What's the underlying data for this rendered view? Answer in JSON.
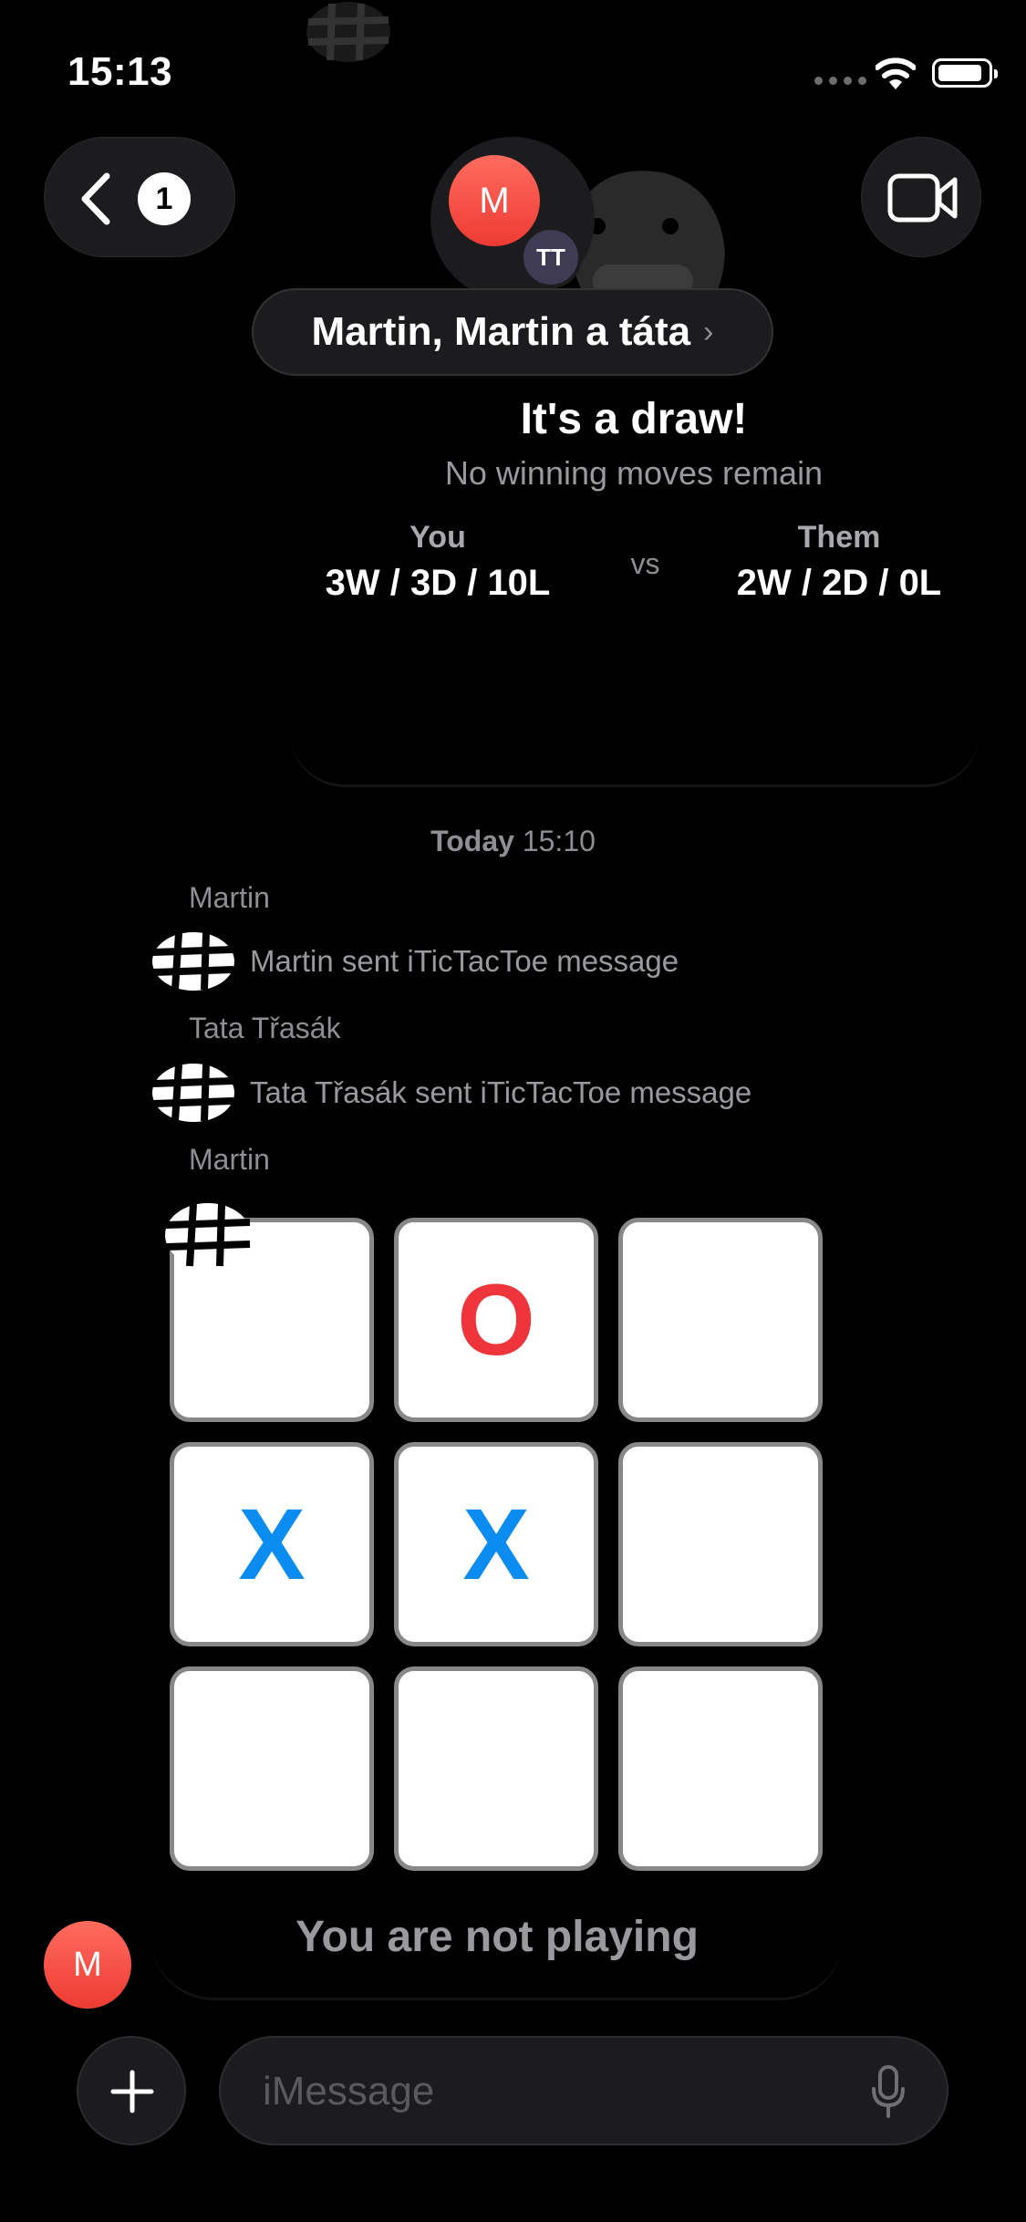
{
  "status_bar": {
    "time": "15:13"
  },
  "header": {
    "back_badge": "1",
    "avatar_initial": "M",
    "avatar_secondary": "TT",
    "title": "Martin, Martin a táta",
    "title_chevron": "›"
  },
  "game_result": {
    "title": "It's a draw!",
    "subtitle": "No winning moves remain",
    "you_label": "You",
    "you_score": "3W / 3D / 10L",
    "vs": "vs",
    "them_label": "Them",
    "them_score": "2W / 2D / 0L"
  },
  "messages": {
    "timestamp_day": "Today",
    "timestamp_time": "15:10",
    "items": [
      {
        "sender": "Martin",
        "text": "Martin sent iTicTacToe message"
      },
      {
        "sender": "Tata Třasák",
        "text": "Tata Třasák sent iTicTacToe message"
      }
    ],
    "last_sender": "Martin"
  },
  "board": {
    "cells": [
      "",
      "O",
      "",
      "X",
      "X",
      "",
      "",
      "",
      ""
    ],
    "status": "You are not playing"
  },
  "bottom_avatar": "M",
  "composer": {
    "placeholder": "iMessage"
  },
  "colors": {
    "x": "#0a8cf0",
    "o": "#f0343c",
    "avatar": "#ee3b33"
  }
}
